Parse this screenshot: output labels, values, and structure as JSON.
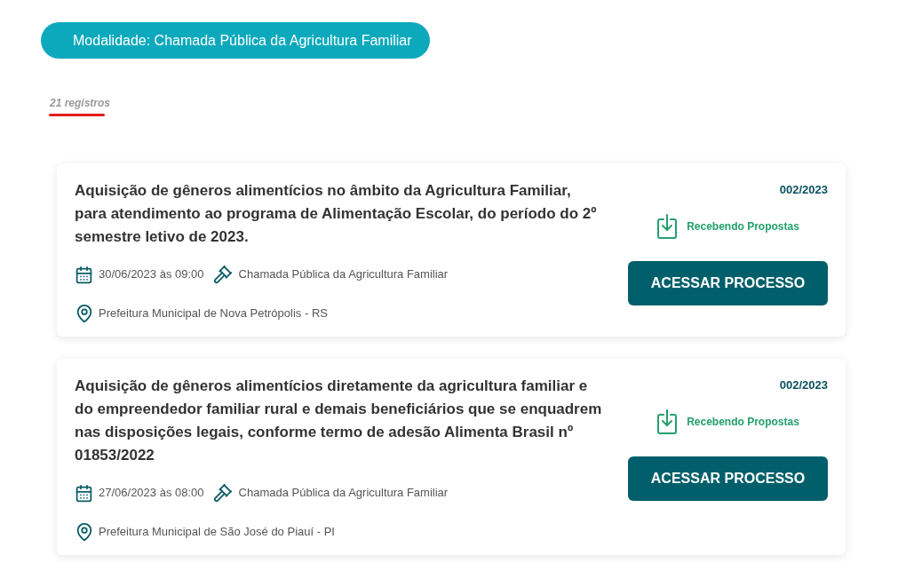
{
  "filter_chip": {
    "label": "Modalidade: Chamada Pública da Agricultura Familiar"
  },
  "record_count": "21 registros",
  "processes": [
    {
      "title": "Aquisição de gêneros alimentícios no âmbito da Agricultura Familiar, para atendimento ao programa de Alimentação Escolar, do período do 2º semestre letivo de 2023.",
      "date": "30/06/2023 às 09:00",
      "modality": "Chamada Pública da Agricultura Familiar",
      "location": "Prefeitura Municipal de Nova Petrópolis - RS",
      "number": "002/2023",
      "status": "Recebendo Propostas",
      "button": "ACESSAR PROCESSO"
    },
    {
      "title": "Aquisição de gêneros alimentícios diretamente da agricultura familiar e do empreendedor familiar rural e demais beneficiários que se enquadrem nas disposições legais, conforme termo de adesão Alimenta Brasil nº 01853/2022",
      "date": "27/06/2023 às 08:00",
      "modality": "Chamada Pública da Agricultura Familiar",
      "location": "Prefeitura Municipal de São José do Piauí - PI",
      "number": "002/2023",
      "status": "Recebendo Propostas",
      "button": "ACESSAR PROCESSO"
    }
  ]
}
